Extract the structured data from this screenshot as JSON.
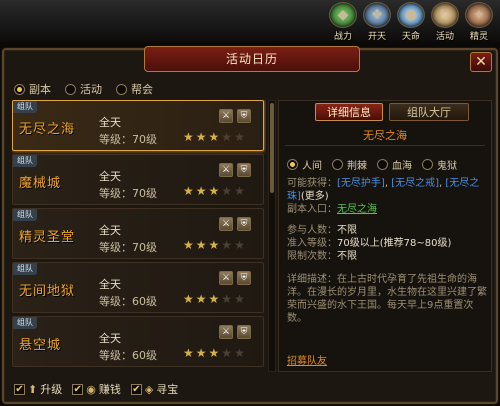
{
  "top_icons": [
    {
      "label": "战力",
      "icon": "shield-gem-icon",
      "color": "#3c8a3c",
      "glyph": "◆"
    },
    {
      "label": "开天",
      "icon": "wings-icon",
      "color": "#3a5f8a",
      "glyph": "❖"
    },
    {
      "label": "天命",
      "icon": "orb-icon",
      "color": "#2a7ab8",
      "glyph": "●"
    },
    {
      "label": "活动",
      "icon": "scroll-icon",
      "color": "#8a6a3c",
      "glyph": "✎"
    },
    {
      "label": "精灵",
      "icon": "sprite-icon",
      "color": "#6a4a3a",
      "glyph": "✦"
    }
  ],
  "window": {
    "title": "活动日历",
    "close": "✕"
  },
  "categories": [
    {
      "label": "副本",
      "selected": true
    },
    {
      "label": "活动",
      "selected": false
    },
    {
      "label": "帮会",
      "selected": false
    }
  ],
  "list": [
    {
      "tag": "组队",
      "name": "无尽之海",
      "time": "全天",
      "level": "等级：70级",
      "stars": 3,
      "max_stars": 5,
      "selected": true
    },
    {
      "tag": "组队",
      "name": "魔械城",
      "time": "全天",
      "level": "等级：70级",
      "stars": 3,
      "max_stars": 5,
      "selected": false
    },
    {
      "tag": "组队",
      "name": "精灵圣堂",
      "time": "全天",
      "level": "等级：70级",
      "stars": 3,
      "max_stars": 5,
      "selected": false
    },
    {
      "tag": "组队",
      "name": "无间地狱",
      "time": "全天",
      "level": "等级：60级",
      "stars": 3,
      "max_stars": 5,
      "selected": false
    },
    {
      "tag": "组队",
      "name": "悬空城",
      "time": "全天",
      "level": "等级：60级",
      "stars": 3,
      "max_stars": 5,
      "selected": false
    }
  ],
  "panel": {
    "tabs": [
      {
        "label": "详细信息",
        "active": true
      },
      {
        "label": "组队大厅",
        "active": false
      }
    ],
    "title": "无尽之海",
    "modes": [
      {
        "label": "人间",
        "selected": true
      },
      {
        "label": "荆棘",
        "selected": false
      },
      {
        "label": "血海",
        "selected": false
      },
      {
        "label": "鬼狱",
        "selected": false
      }
    ],
    "rewards_label": "可能获得：",
    "rewards": [
      "[无尽护手]",
      "[无尽之戒]",
      "[无尽之珠]"
    ],
    "more": "(更多)",
    "entry_label": "副本入口：",
    "entry_value": "无尽之海",
    "players_label": "参与人数：",
    "players_value": "不限",
    "access_label": "准入等级：",
    "access_value": "70级以上(推荐78~80级)",
    "limit_label": "限制次数：",
    "limit_value": "不限",
    "desc_label": "详细描述：",
    "desc_text": "在上古时代孕育了先祖生命的海洋。在漫长的岁月里，水生物在这里兴建了繁荣而兴盛的水下王国。每天早上9点重置次数。",
    "recruit": "招募队友"
  },
  "footer": [
    {
      "label": "升级",
      "checked": true,
      "icon": "upgrade-icon",
      "glyph": "⬆"
    },
    {
      "label": "赚钱",
      "checked": true,
      "icon": "money-icon",
      "glyph": "◉"
    },
    {
      "label": "寻宝",
      "checked": true,
      "icon": "treasure-icon",
      "glyph": "◈"
    }
  ]
}
